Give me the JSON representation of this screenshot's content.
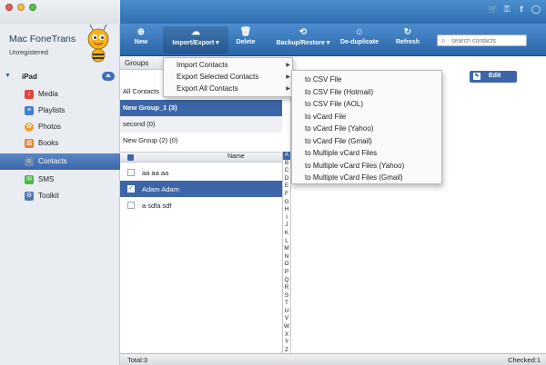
{
  "app": {
    "title": "Mac FoneTrans",
    "registration": "Unregistered"
  },
  "top_icons": [
    "cart-icon",
    "key-icon",
    "facebook-icon",
    "chat-icon"
  ],
  "device": {
    "name": "iPad"
  },
  "sidebar": {
    "items": [
      {
        "label": "Media",
        "icon": "music-icon",
        "color": "#e0463b"
      },
      {
        "label": "Playlists",
        "icon": "playlist-icon",
        "color": "#3f7fd0"
      },
      {
        "label": "Photos",
        "icon": "photos-icon",
        "color": "#e9a02c"
      },
      {
        "label": "Books",
        "icon": "books-icon",
        "color": "#e7852a"
      },
      {
        "label": "Contacts",
        "icon": "contacts-icon",
        "color": "#6f8aa8"
      },
      {
        "label": "SMS",
        "icon": "sms-icon",
        "color": "#4cb84a"
      },
      {
        "label": "Toolkit",
        "icon": "toolkit-icon",
        "color": "#4e79b5"
      }
    ],
    "active": "Contacts"
  },
  "toolbar": {
    "new_label": "New",
    "import_export_label": "Import/Export",
    "delete_label": "Delete",
    "backup_restore_label": "Backup/Restore",
    "deduplicate_label": "De-duplicate",
    "refresh_label": "Refresh",
    "search_placeholder": "search contacts"
  },
  "groups": {
    "header": "Groups",
    "items": [
      {
        "label": "All Contacts"
      },
      {
        "label": "New Group_1  (3)"
      },
      {
        "label": "second  (0)"
      },
      {
        "label": "New Group (2)  (0)"
      }
    ]
  },
  "contacts": {
    "column_name": "Name",
    "rows": [
      {
        "name": "aa aa aa",
        "checked": false
      },
      {
        "name": "Adam Adam",
        "checked": true
      },
      {
        "name": "a sdfa sdf",
        "checked": false
      }
    ]
  },
  "alphabet": [
    "A",
    "B",
    "C",
    "D",
    "E",
    "F",
    "G",
    "H",
    "I",
    "J",
    "K",
    "L",
    "M",
    "N",
    "O",
    "P",
    "Q",
    "R",
    "S",
    "T",
    "U",
    "V",
    "W",
    "X",
    "Y",
    "Z",
    "#"
  ],
  "detail": {
    "edit_label": "Edit"
  },
  "import_export_menu": {
    "items": [
      "Import Contacts",
      "Export Selected Contacts",
      "Export All Contacts"
    ]
  },
  "export_submenu": {
    "items": [
      "to CSV File",
      "to CSV File (Hotmail)",
      "to CSV File (AOL)",
      "to vCard File",
      "to vCard File (Yahoo)",
      "to vCard File (Gmail)",
      "to Multiple vCard Files",
      "to Multiple vCard Files (Yahoo)",
      "to Multiple vCard Files (Gmail)"
    ]
  },
  "status": {
    "total": "Total:3",
    "checked": "Checked:1"
  },
  "colors": {
    "toolbar": "#3c7dc4",
    "selection": "#3c66a8",
    "sidebar_bg": "#e9edf2"
  }
}
